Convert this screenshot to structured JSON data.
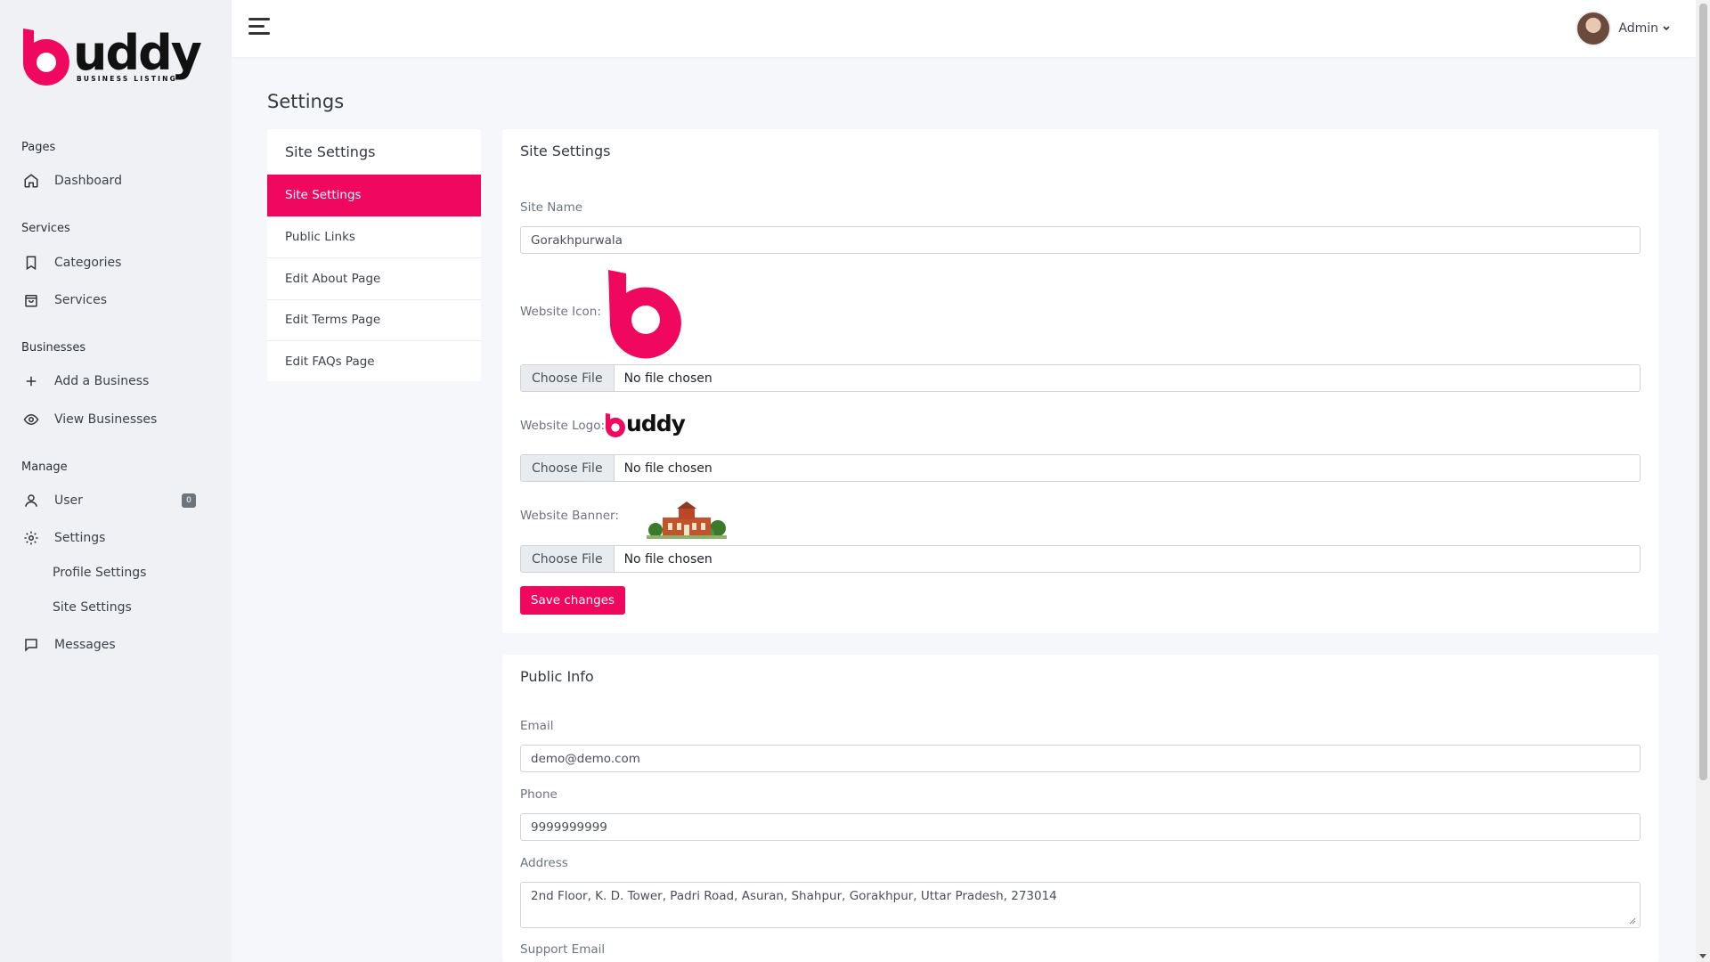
{
  "brand": {
    "word": "uddy",
    "tagline": "BUSINESS LISTING",
    "accent": "#f0085e"
  },
  "sidebar": {
    "sections": {
      "pages": "Pages",
      "services": "Services",
      "businesses": "Businesses",
      "manage": "Manage"
    },
    "items": {
      "dashboard": "Dashboard",
      "categories": "Categories",
      "services": "Services",
      "add_business": "Add a Business",
      "view_businesses": "View Businesses",
      "user": "User",
      "user_badge": "0",
      "settings": "Settings",
      "profile_settings": "Profile Settings",
      "site_settings": "Site Settings",
      "messages": "Messages"
    }
  },
  "topbar": {
    "user_name": "Admin"
  },
  "page": {
    "title": "Settings"
  },
  "settings_menu": {
    "title": "Site Settings",
    "items": [
      "Site Settings",
      "Public Links",
      "Edit About Page",
      "Edit Terms Page",
      "Edit FAQs Page"
    ]
  },
  "site_settings": {
    "title": "Site Settings",
    "site_name_label": "Site Name",
    "site_name_value": "Gorakhpurwala",
    "icon_label": "Website Icon:",
    "logo_label": "Website Logo:",
    "banner_label": "Website Banner:",
    "choose_file": "Choose File",
    "no_file": "No file chosen",
    "save": "Save changes"
  },
  "public_info": {
    "title": "Public Info",
    "email_label": "Email",
    "email_value": "demo@demo.com",
    "phone_label": "Phone",
    "phone_value": "9999999999",
    "address_label": "Address",
    "address_value": "2nd Floor, K. D. Tower, Padri Road, Asuran, Shahpur, Gorakhpur, Uttar Pradesh, 273014",
    "support_email_label": "Support Email"
  }
}
